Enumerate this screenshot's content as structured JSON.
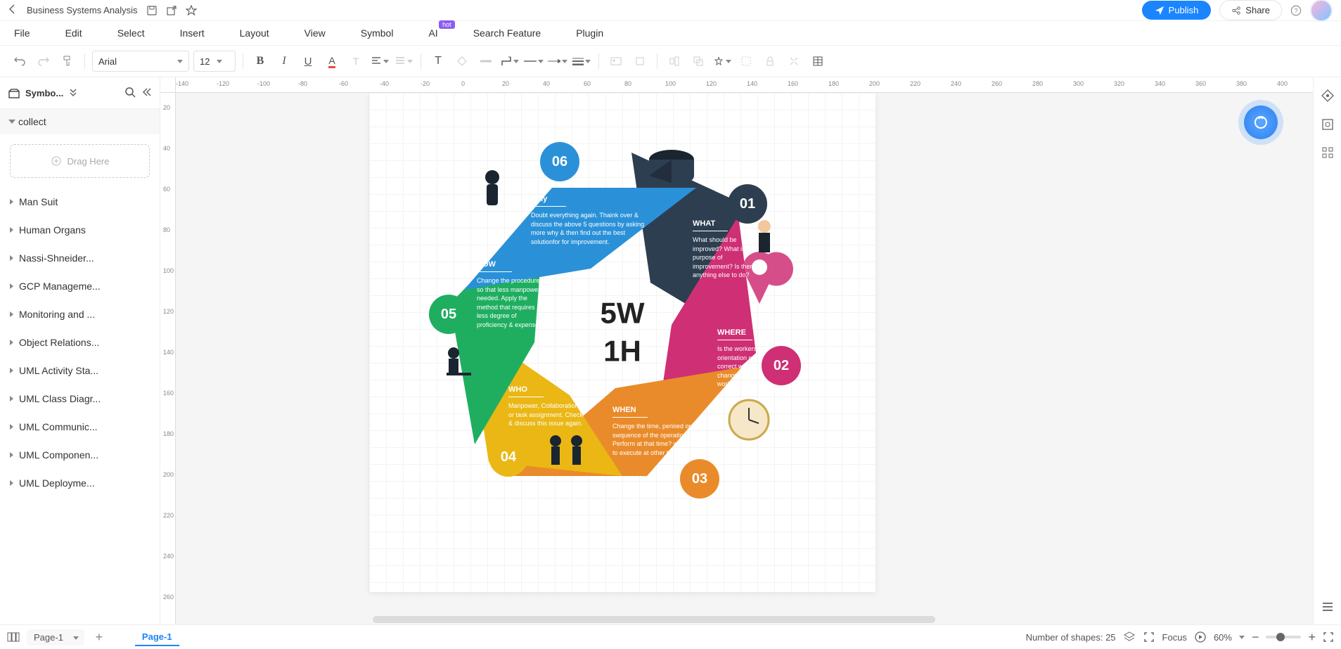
{
  "titlebar": {
    "doc_title": "Business Systems Analysis",
    "publish": "Publish",
    "share": "Share"
  },
  "menu": {
    "items": [
      "File",
      "Edit",
      "Select",
      "Insert",
      "Layout",
      "View",
      "Symbol",
      "AI",
      "Search Feature",
      "Plugin"
    ],
    "hot_badge": "hot"
  },
  "toolbar": {
    "font": "Arial",
    "size": "12"
  },
  "sidebar": {
    "title": "Symbo...",
    "collect": "collect",
    "drag_here": "Drag Here",
    "categories": [
      "Man Suit",
      "Human Organs",
      "Nassi-Shneider...",
      "GCP Manageme...",
      "Monitoring and ...",
      "Object Relations...",
      "UML Activity Sta...",
      "UML Class Diagr...",
      "UML Communic...",
      "UML Componen...",
      "UML Deployme..."
    ]
  },
  "ruler": {
    "h": [
      "-140",
      "-120",
      "-100",
      "-80",
      "-60",
      "-40",
      "-20",
      "0",
      "20",
      "40",
      "60",
      "80",
      "100",
      "120",
      "140",
      "160",
      "180",
      "200",
      "220",
      "240",
      "260",
      "280",
      "300",
      "320",
      "340",
      "360",
      "380",
      "400"
    ],
    "v": [
      "20",
      "40",
      "60",
      "80",
      "100",
      "120",
      "140",
      "160",
      "180",
      "200",
      "220",
      "240",
      "260"
    ]
  },
  "diagram": {
    "center_line1": "5W",
    "center_line2": "1H",
    "segments": [
      {
        "num": "01",
        "color": "#2d3e50",
        "title": "WHAT",
        "text": "What should be improved? What is the purpose of improvement? Is there anything else to do?",
        "circle_color": "#2d3e50"
      },
      {
        "num": "02",
        "color": "#cf2f74",
        "title": "WHERE",
        "text": "Is the workers orientation or method correct when changing the workplace?",
        "circle_color": "#cf2f74"
      },
      {
        "num": "03",
        "color": "#e98b2a",
        "title": "WHEN",
        "text": "Change the time, perioed or swquence of the operation. Why Perform at that time? will it be better to execute at other time?",
        "circle_color": "#e98b2a"
      },
      {
        "num": "04",
        "color": "#eab715",
        "title": "WHO",
        "text": "Manpower, Collaboration or task assignment. Check & discuss this issue again.",
        "circle_color": "#eab715"
      },
      {
        "num": "05",
        "color": "#1fae60",
        "title": "HOW",
        "text": "Change the procedure so that less manpower is needed. Apply the method that requires less degree of proficiency & expense",
        "circle_color": "#1fae60"
      },
      {
        "num": "06",
        "color": "#2a91d8",
        "title": "Why",
        "text": "Doubt everything again. Thaink over & discuss the above 5 questions by asking more why & then find out the best solutionfor for improvement.",
        "circle_color": "#2a91d8"
      }
    ]
  },
  "statusbar": {
    "page_select": "Page-1",
    "active_tab": "Page-1",
    "shapes": "Number of shapes: 25",
    "focus": "Focus",
    "zoom": "60%"
  }
}
